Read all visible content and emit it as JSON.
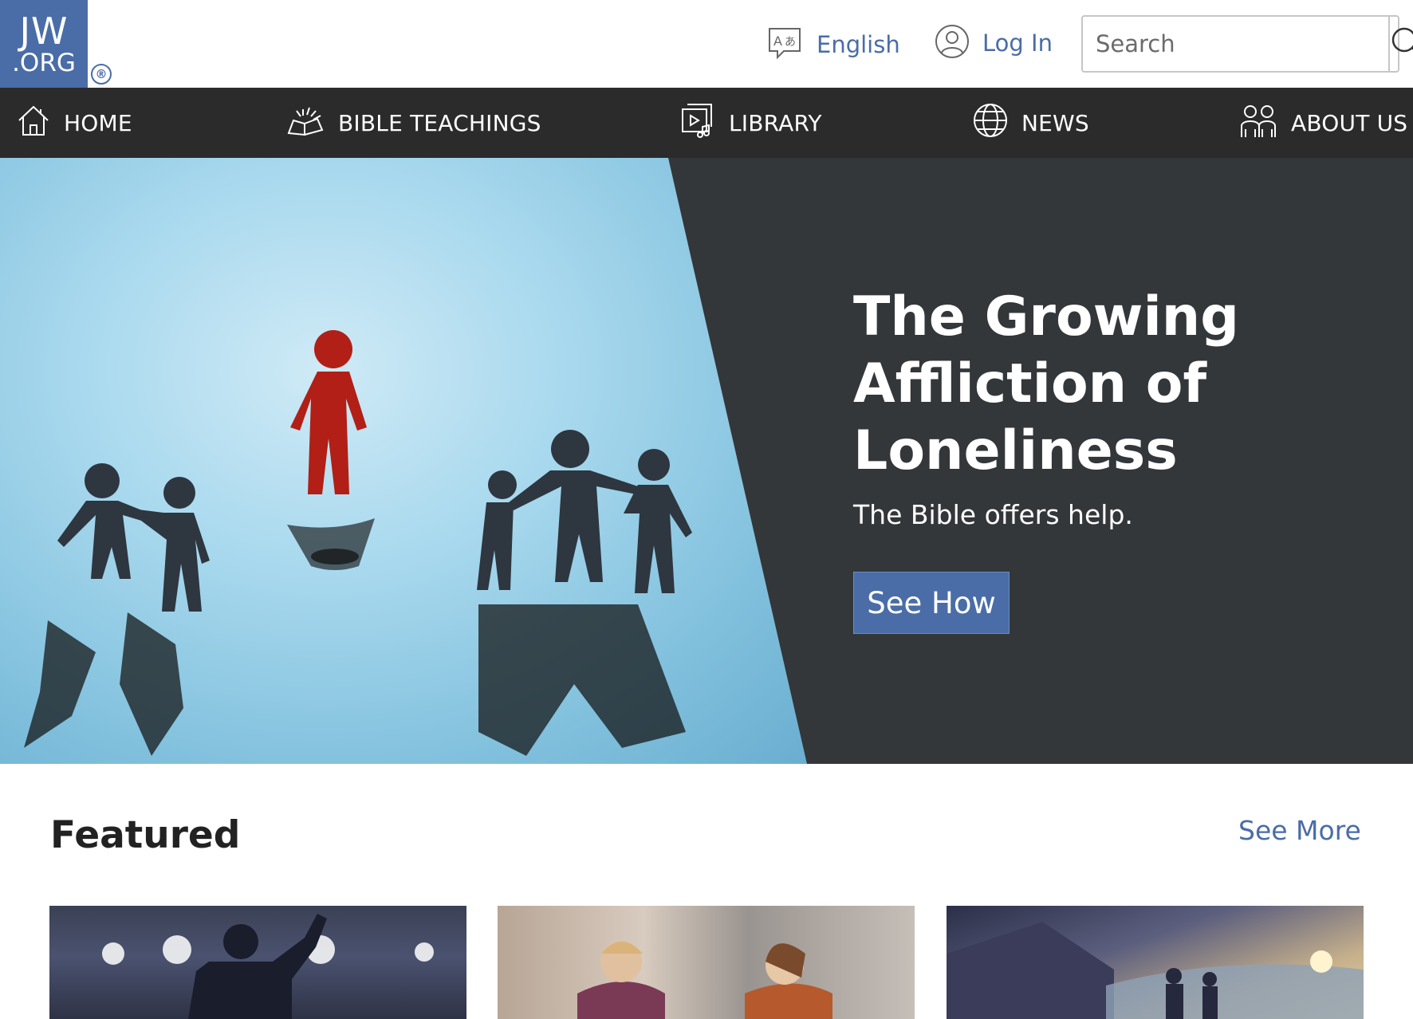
{
  "header": {
    "logo_line1": "JW",
    "logo_line2": ".ORG",
    "registered_mark": "®",
    "language_label": "English",
    "language_icon": "translate-icon",
    "login_label": "Log In",
    "login_icon": "user-circle-icon",
    "search_placeholder": "Search",
    "search_icon": "search-icon"
  },
  "nav": {
    "items": [
      {
        "label": "HOME",
        "icon": "home-icon"
      },
      {
        "label": "BIBLE TEACHINGS",
        "icon": "open-bible-icon"
      },
      {
        "label": "LIBRARY",
        "icon": "media-library-icon"
      },
      {
        "label": "NEWS",
        "icon": "globe-icon"
      },
      {
        "label": "ABOUT US",
        "icon": "people-icon"
      }
    ]
  },
  "hero": {
    "title": "The Growing Affliction of Loneliness",
    "subtitle": "The Bible offers help.",
    "cta_label": "See How"
  },
  "featured": {
    "title": "Featured",
    "see_more_label": "See More"
  },
  "colors": {
    "brand": "#4a6da7",
    "nav_bg": "#2b2b2b",
    "hero_bg": "#33373a"
  }
}
